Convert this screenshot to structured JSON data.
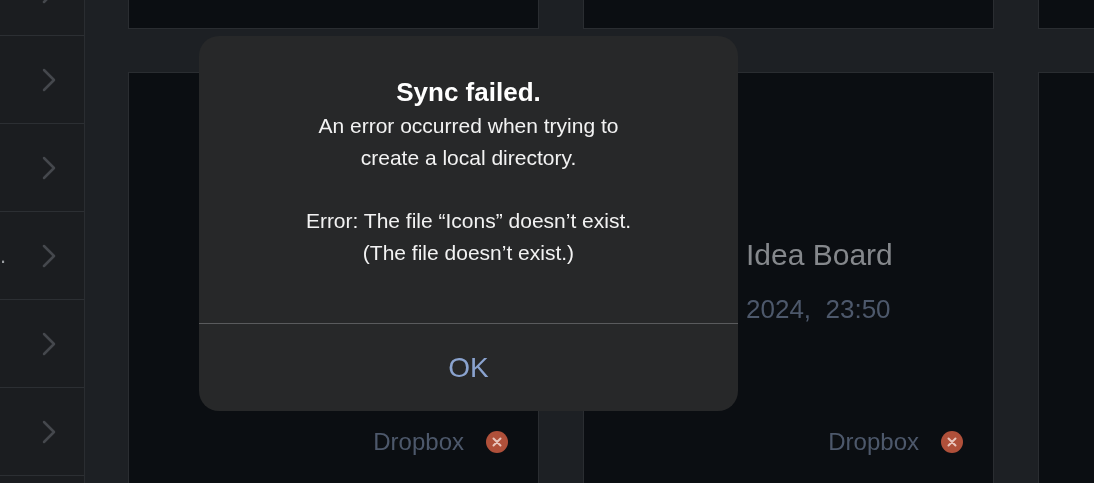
{
  "sidebar": {
    "items": [
      {
        "kind": "row"
      },
      {
        "kind": "row"
      },
      {
        "kind": "row"
      },
      {
        "kind": "row",
        "text": "."
      },
      {
        "kind": "row"
      },
      {
        "kind": "row"
      }
    ]
  },
  "cards": [
    {
      "storage": "Dropbox",
      "sync_failed": true
    },
    {
      "title": "Idea Board",
      "date": "2024,  23:50",
      "storage": "Dropbox",
      "sync_failed": true
    }
  ],
  "alert": {
    "title": "Sync failed.",
    "paragraphs": [
      [
        "An error occurred when trying to",
        "create a local directory."
      ],
      [
        "Error: The file “Icons” doesn’t exist.",
        "(The file doesn’t exist.)"
      ]
    ],
    "button": "OK"
  }
}
